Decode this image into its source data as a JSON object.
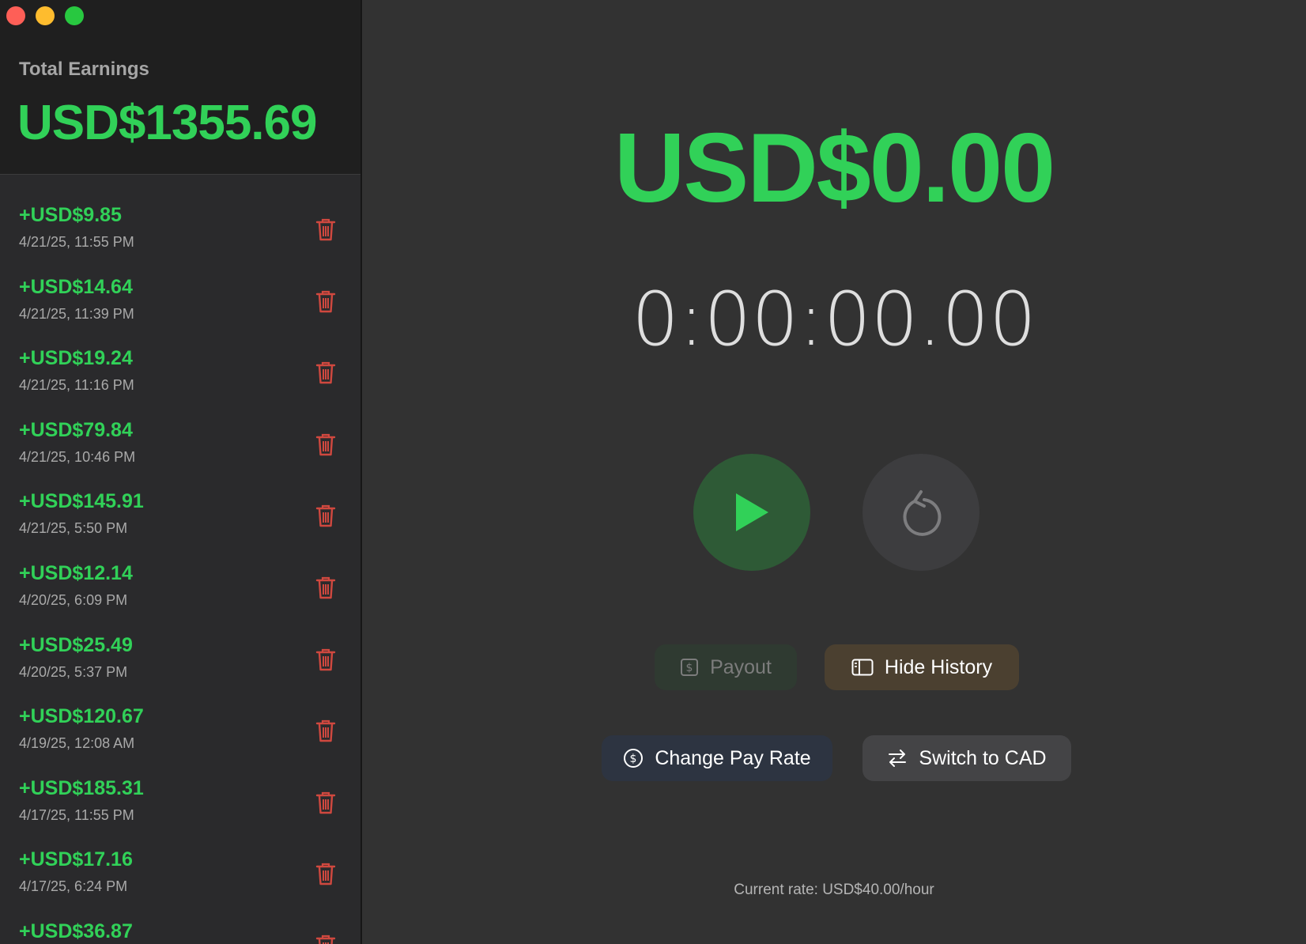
{
  "window": {
    "controls": [
      "close",
      "minimize",
      "zoom"
    ]
  },
  "sidebar": {
    "total_label": "Total Earnings",
    "total_value": "USD$1355.69",
    "history": [
      {
        "amount": "+USD$9.85",
        "date": "4/21/25, 11:55 PM"
      },
      {
        "amount": "+USD$14.64",
        "date": "4/21/25, 11:39 PM"
      },
      {
        "amount": "+USD$19.24",
        "date": "4/21/25, 11:16 PM"
      },
      {
        "amount": "+USD$79.84",
        "date": "4/21/25, 10:46 PM"
      },
      {
        "amount": "+USD$145.91",
        "date": "4/21/25, 5:50 PM"
      },
      {
        "amount": "+USD$12.14",
        "date": "4/20/25, 6:09 PM"
      },
      {
        "amount": "+USD$25.49",
        "date": "4/20/25, 5:37 PM"
      },
      {
        "amount": "+USD$120.67",
        "date": "4/19/25, 12:08 AM"
      },
      {
        "amount": "+USD$185.31",
        "date": "4/17/25, 11:55 PM"
      },
      {
        "amount": "+USD$17.16",
        "date": "4/17/25, 6:24 PM"
      },
      {
        "amount": "+USD$36.87",
        "date": ""
      }
    ]
  },
  "main": {
    "current_earnings": "USD$0.00",
    "timer": "0:00:00.00",
    "buttons": {
      "payout": "Payout",
      "hide_history": "Hide History",
      "change_pay_rate": "Change Pay Rate",
      "switch_currency": "Switch to CAD"
    },
    "current_rate": "Current rate: USD$40.00/hour"
  },
  "colors": {
    "accent_green": "#31d158",
    "delete_red": "#d0483f",
    "background": "#323232",
    "sidebar": "#2a2a2c"
  },
  "icons": [
    "play-icon",
    "reset-icon",
    "trash-icon",
    "dollar-doc-icon",
    "sidebar-icon",
    "dollar-circle-icon",
    "swap-arrows-icon"
  ]
}
